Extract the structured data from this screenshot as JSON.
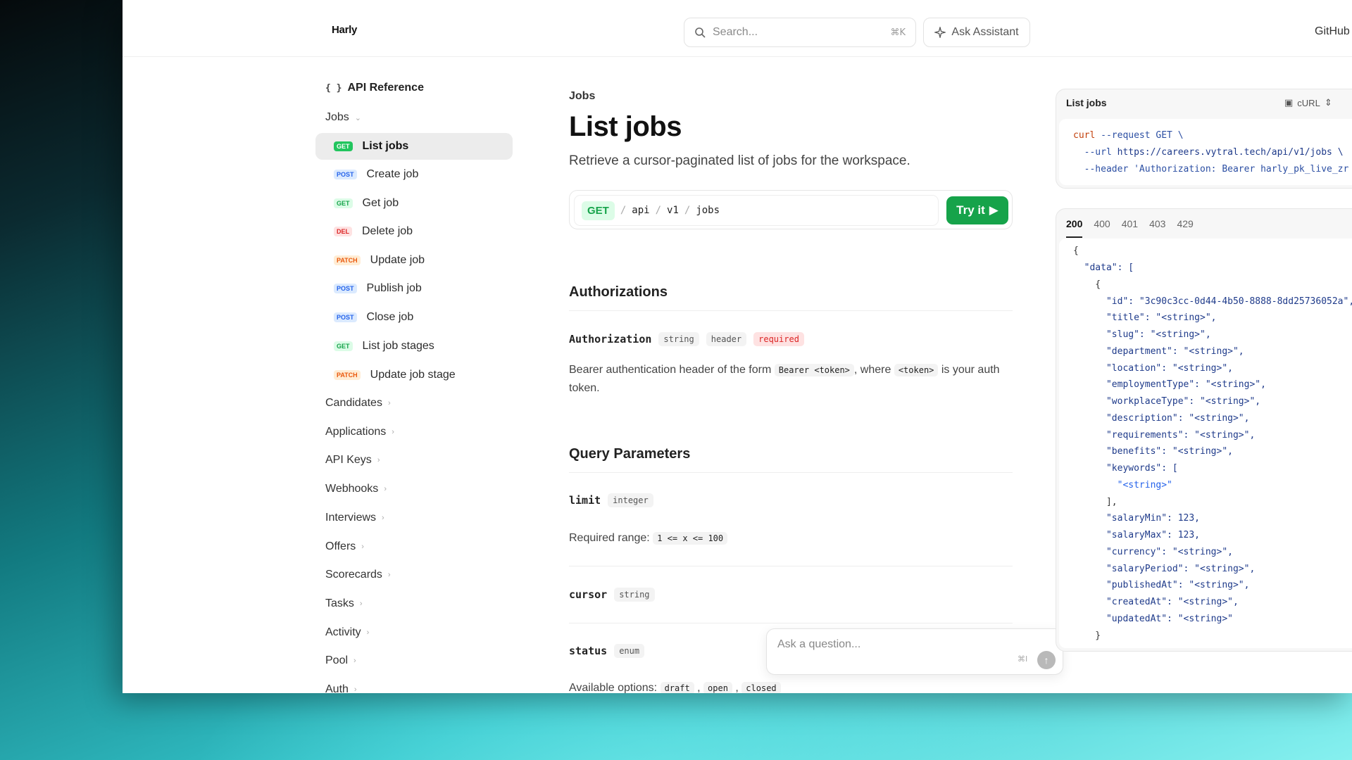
{
  "header": {
    "logo": "Harly",
    "search_placeholder": "Search...",
    "search_shortcut": "⌘K",
    "ask_assistant": "Ask Assistant",
    "github": "GitHub"
  },
  "sidebar": {
    "title": "API Reference",
    "group_jobs": "Jobs",
    "items": [
      {
        "method": "GET",
        "label": "List jobs"
      },
      {
        "method": "POST",
        "label": "Create job"
      },
      {
        "method": "GET",
        "label": "Get job"
      },
      {
        "method": "DEL",
        "label": "Delete job"
      },
      {
        "method": "PATCH",
        "label": "Update job"
      },
      {
        "method": "POST",
        "label": "Publish job"
      },
      {
        "method": "POST",
        "label": "Close job"
      },
      {
        "method": "GET",
        "label": "List job stages"
      },
      {
        "method": "PATCH",
        "label": "Update job stage"
      }
    ],
    "groups": [
      "Candidates",
      "Applications",
      "API Keys",
      "Webhooks",
      "Interviews",
      "Offers",
      "Scorecards",
      "Tasks",
      "Activity",
      "Pool",
      "Auth"
    ]
  },
  "main": {
    "breadcrumb": "Jobs",
    "title": "List jobs",
    "subtitle": "Retrieve a cursor-paginated list of jobs for the workspace.",
    "endpoint": {
      "method": "GET",
      "seg1": "api",
      "seg2": "v1",
      "seg3": "jobs"
    },
    "try_label": "Try it",
    "auth_heading": "Authorizations",
    "auth": {
      "name": "Authorization",
      "type": "string",
      "location": "header",
      "required": "required",
      "desc_1": "Bearer authentication header of the form",
      "code_1": "Bearer <token>",
      "desc_2": ", where",
      "code_2": "<token>",
      "desc_3": "is your auth token."
    },
    "query_heading": "Query Parameters",
    "limit": {
      "name": "limit",
      "type": "integer",
      "range_label": "Required range:",
      "range": "1 <= x <= 100"
    },
    "cursor": {
      "name": "cursor",
      "type": "string"
    },
    "status": {
      "name": "status",
      "type": "enum",
      "options_label": "Available options:",
      "options": [
        "draft",
        "open",
        "closed"
      ]
    }
  },
  "ask_box": {
    "placeholder": "Ask a question...",
    "shortcut": "⌘I"
  },
  "request_panel": {
    "title": "List jobs",
    "lang": "cURL",
    "line1a": "curl",
    "line1b": " --request GET \\",
    "line2a": "  --url ",
    "line2b": "https://careers.vytral.tech/api/v1/jobs \\",
    "line3": "  --header 'Authorization: Bearer harly_pk_live_zr"
  },
  "response_panel": {
    "tabs": [
      "200",
      "400",
      "401",
      "403",
      "429"
    ],
    "lines": [
      "{",
      "  \"data\": [",
      "    {",
      "      \"id\": \"3c90c3cc-0d44-4b50-8888-8dd25736052a\",",
      "      \"title\": \"<string>\",",
      "      \"slug\": \"<string>\",",
      "      \"department\": \"<string>\",",
      "      \"location\": \"<string>\",",
      "      \"employmentType\": \"<string>\",",
      "      \"workplaceType\": \"<string>\",",
      "      \"description\": \"<string>\",",
      "      \"requirements\": \"<string>\",",
      "      \"benefits\": \"<string>\",",
      "      \"keywords\": [",
      "        \"<string>\"",
      "      ],",
      "      \"salaryMin\": 123,",
      "      \"salaryMax\": 123,",
      "      \"currency\": \"<string>\",",
      "      \"salaryPeriod\": \"<string>\",",
      "      \"publishedAt\": \"<string>\",",
      "      \"createdAt\": \"<string>\",",
      "      \"updatedAt\": \"<string>\"",
      "    }"
    ]
  }
}
